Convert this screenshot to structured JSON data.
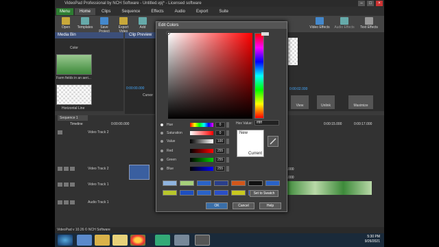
{
  "window": {
    "title": "VideoPad Professional by NCH Software - Untitled.vpj* - Licensed software"
  },
  "menubar": {
    "menu_button": "Menu",
    "tabs": [
      "Home",
      "Clips",
      "Sequence",
      "Effects",
      "Audio",
      "Export",
      "Suite"
    ]
  },
  "ribbon": {
    "left": [
      "Open",
      "Templates",
      "Save Project",
      "Export Video",
      "Add"
    ],
    "right": [
      "Video Effects",
      "Audio Effects",
      "Text Effects"
    ]
  },
  "media_bin": {
    "tab_media": "Media Bin",
    "tab_preview": "Clip Preview",
    "item1_caption": "Farm fields in an aeri...",
    "item2_caption": "Horizontal Line",
    "top_caption": "Color"
  },
  "preview": {
    "time_left": "0:00:00.000",
    "time_right": "0:00:02.000",
    "cursor_label": "Cursor",
    "view_label": "View",
    "unlink_label": "Unlink",
    "maximize_label": "Maximize"
  },
  "timeline": {
    "sequence_tab": "Sequence 1",
    "timeline_label": "Timeline",
    "time_markers": [
      "0:00:00.000",
      "0:00:15.000",
      "0:00:17.000"
    ],
    "tracks": [
      "Video Track 2",
      "Video Track 2",
      "Video Track 1",
      "Audio Track 1"
    ],
    "behind_values": [
      "3.000",
      "3.000"
    ]
  },
  "dialog": {
    "title": "Edit Colors",
    "rows": [
      {
        "label": "Hue",
        "value": "0"
      },
      {
        "label": "Saturation",
        "value": "0"
      },
      {
        "label": "Value",
        "value": "100"
      },
      {
        "label": "Red",
        "value": "255"
      },
      {
        "label": "Green",
        "value": "255"
      },
      {
        "label": "Blue",
        "value": "255"
      }
    ],
    "hex_label": "Hex Value:",
    "hex_value": "ffffff",
    "new_label": "New",
    "current_label": "Current",
    "set_swatch": "Set to Swatch",
    "ok": "OK",
    "cancel": "Cancel",
    "help": "Help",
    "swatches_row1": [
      "#8fb4e0",
      "#a6d07a",
      "#2a63c8",
      "#2a3f8c",
      "#d2571a",
      "#111111",
      "#2a63c8"
    ],
    "swatches_row2": [
      "#b9c72a",
      "#1e4fc0",
      "#2a63c8",
      "#2a4fc8",
      "#c8c81e",
      "#1e40c0"
    ]
  },
  "statusbar": {
    "text": "VideoPad v 10.26 © NCH Software"
  },
  "taskbar": {
    "time": "5:30 PM",
    "date": "9/26/2021"
  }
}
